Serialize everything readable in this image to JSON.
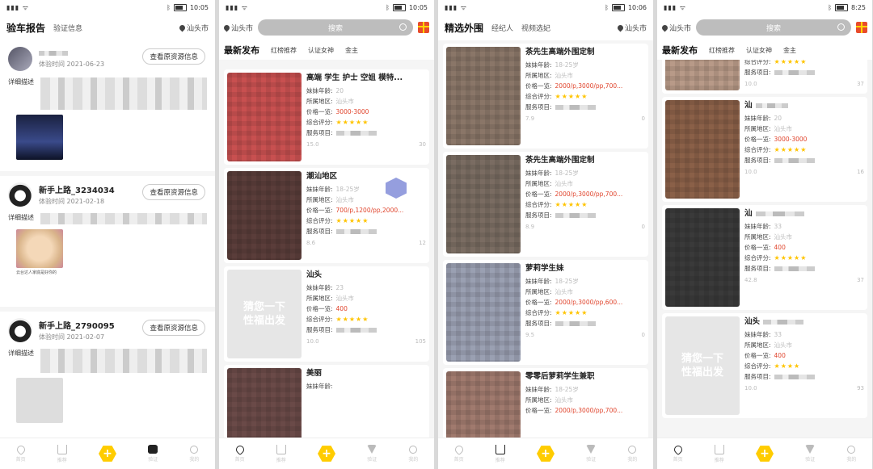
{
  "status_bars": [
    {
      "time": "10:05"
    },
    {
      "time": "10:05"
    },
    {
      "time": "10:06"
    },
    {
      "time": "8:25"
    }
  ],
  "panel1": {
    "tabs": [
      "验车报告",
      "验证信息"
    ],
    "city": "汕头市",
    "view_button": "查看原资源信息",
    "desc_label": "详细描述",
    "reviews": [
      {
        "name": "",
        "time": "体验时间 2021-06-23"
      },
      {
        "name": "新手上路_3234034",
        "time": "体验时间 2021-02-18",
        "img_caption": "云台达人家底是好你的"
      },
      {
        "name": "新手上路_2790095",
        "time": "体验时间 2021-02-07"
      }
    ]
  },
  "panel2": {
    "city": "汕头市",
    "search_placeholder": "搜索",
    "categories": [
      "最新发布",
      "红榜推荐",
      "认证女神",
      "金主"
    ],
    "cards": [
      {
        "title": "高端 学生 护士 空姐 模特...",
        "age": "20",
        "area": "汕头市",
        "price": "3000-3000",
        "stars": "★★★★★",
        "views": "15.0",
        "likes": "30"
      },
      {
        "title": "潮汕地区",
        "age": "18-25岁",
        "area": "汕头市",
        "price": "700/p,1200/pp,2000...",
        "stars": "★★★★★",
        "views": "8.6",
        "likes": "12"
      },
      {
        "title": "汕头",
        "age": "23",
        "area": "汕头市",
        "price": "400",
        "stars": "★★★★★",
        "views": "10.0",
        "likes": "105",
        "placeholder": "猜您一下\n性福出发"
      },
      {
        "title": "美丽",
        "age": "",
        "area": "",
        "price": "",
        "stars": "",
        "views": "",
        "likes": ""
      }
    ]
  },
  "panel3": {
    "tabs": [
      "精选外围",
      "经纪人",
      "视频选妃"
    ],
    "city": "汕头市",
    "cards": [
      {
        "title": "茶先生高端外围定制",
        "age": "18-25岁",
        "area": "汕头市",
        "price": "2000/p,3000/pp,700...",
        "stars": "★★★★★",
        "views": "7.9",
        "likes": "0"
      },
      {
        "title": "茶先生高端外围定制",
        "age": "18-25岁",
        "area": "汕头市",
        "price": "2000/p,3000/pp,700...",
        "stars": "★★★★★",
        "views": "8.9",
        "likes": "0"
      },
      {
        "title": "萝莉学生妹",
        "age": "18-25岁",
        "area": "汕头市",
        "price": "2000/p,3000/pp,600...",
        "stars": "★★★★★",
        "views": "9.5",
        "likes": "0"
      },
      {
        "title": "零零后萝莉学生兼职",
        "age": "18-25岁",
        "area": "汕头市",
        "price": "2000/p,3000/pp,700...",
        "stars": "",
        "views": "",
        "likes": ""
      }
    ]
  },
  "panel4": {
    "city": "汕头市",
    "search_placeholder": "搜索",
    "categories": [
      "最新发布",
      "红榜推荐",
      "认证女神",
      "金主"
    ],
    "cards": [
      {
        "title": "",
        "age": "",
        "area": "",
        "price": "",
        "stars": "★★★★★",
        "views": "10.0",
        "likes": "37",
        "partial": true
      },
      {
        "title": "汕",
        "age": "20",
        "area": "汕头市",
        "price": "3000-3000",
        "stars": "★★★★★",
        "views": "10.0",
        "likes": "16"
      },
      {
        "title": "汕",
        "age": "33",
        "area": "汕头市",
        "price": "400",
        "stars": "★★★★★",
        "views": "42.8",
        "likes": "37"
      },
      {
        "title": "汕头",
        "age": "33",
        "area": "汕头市",
        "price": "400",
        "stars": "★★★★",
        "views": "10.0",
        "likes": "93",
        "placeholder": "猜您一下\n性福出发"
      }
    ]
  },
  "labels": {
    "age": "妹妹年龄:",
    "area": "所属地区:",
    "price": "价格一览:",
    "rating": "综合评分:",
    "service": "服务项目:"
  },
  "nav": [
    "首页",
    "推荐",
    "+",
    "验证",
    "我的"
  ]
}
